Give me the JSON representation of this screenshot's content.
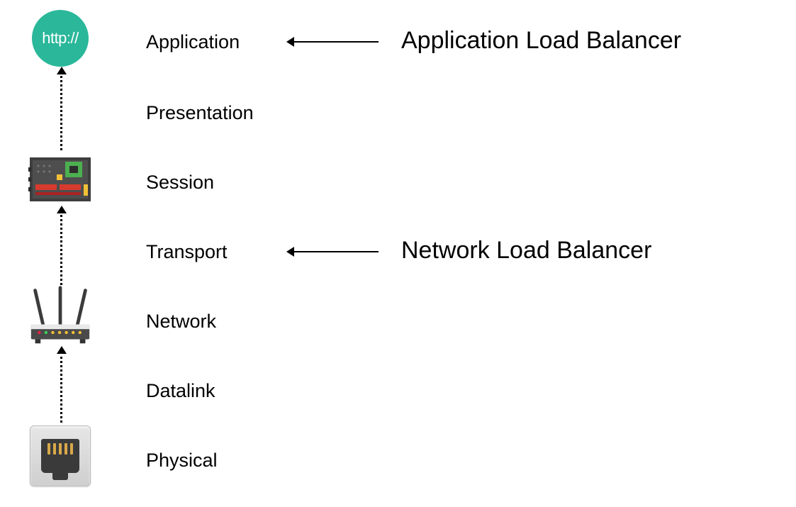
{
  "layers": {
    "application": "Application",
    "presentation": "Presentation",
    "session": "Session",
    "transport": "Transport",
    "network": "Network",
    "datalink": "Datalink",
    "physical": "Physical"
  },
  "icons": {
    "http_label": "http://"
  },
  "annotations": {
    "application_lb": "Application Load Balancer",
    "network_lb": "Network Load Balancer"
  }
}
